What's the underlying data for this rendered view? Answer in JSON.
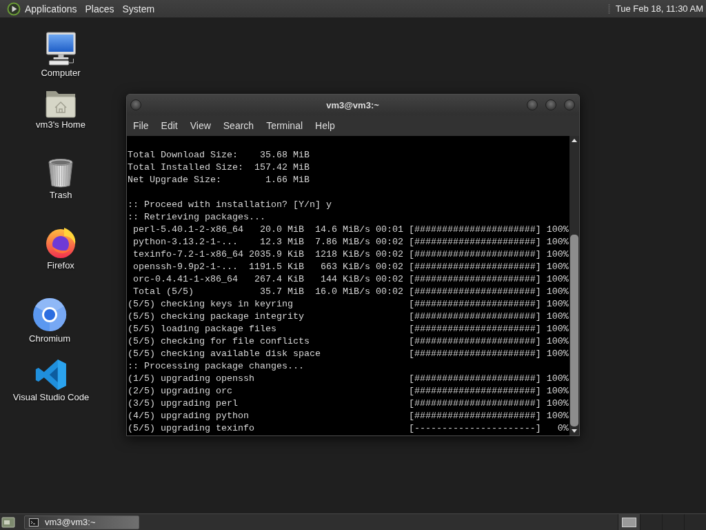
{
  "top_panel": {
    "menus": [
      "Applications",
      "Places",
      "System"
    ],
    "clock": "Tue Feb 18, 11:30 AM"
  },
  "desktop_icons": [
    {
      "kind": "computer",
      "label": "Computer"
    },
    {
      "kind": "home",
      "label": "vm3's Home"
    },
    {
      "kind": "trash",
      "label": "Trash"
    },
    {
      "kind": "firefox",
      "label": "Firefox"
    },
    {
      "kind": "chromium",
      "label": "Chromium"
    },
    {
      "kind": "vscode",
      "label": "Visual Studio Code"
    }
  ],
  "terminal_window": {
    "title": "vm3@vm3:~",
    "menu": [
      "File",
      "Edit",
      "View",
      "Search",
      "Terminal",
      "Help"
    ],
    "sections": [
      {
        "lines": [
          "Total Download Size:    35.68 MiB",
          "Total Installed Size:  157.42 MiB",
          "Net Upgrade Size:        1.66 MiB"
        ]
      },
      {
        "lines": [
          ":: Proceed with installation? [Y/n] y",
          ":: Retrieving packages...",
          " perl-5.40.1-2-x86_64   20.0 MiB  14.6 MiB/s 00:01 [######################] 100%",
          " python-3.13.2-1-...    12.3 MiB  7.86 MiB/s 00:02 [######################] 100%",
          " texinfo-7.2-1-x86_64 2035.9 KiB  1218 KiB/s 00:02 [######################] 100%",
          " openssh-9.9p2-1-...  1191.5 KiB   663 KiB/s 00:02 [######################] 100%",
          " orc-0.4.41-1-x86_64   267.4 KiB   144 KiB/s 00:02 [######################] 100%",
          " Total (5/5)            35.7 MiB  16.0 MiB/s 00:02 [######################] 100%",
          "(5/5) checking keys in keyring                     [######################] 100%",
          "(5/5) checking package integrity                   [######################] 100%",
          "(5/5) loading package files                        [######################] 100%",
          "(5/5) checking for file conflicts                  [######################] 100%",
          "(5/5) checking available disk space                [######################] 100%",
          ":: Processing package changes...",
          "(1/5) upgrading openssh                            [######################] 100%",
          "(2/5) upgrading orc                                [######################] 100%",
          "(3/5) upgrading perl                               [######################] 100%",
          "(4/5) upgrading python                             [######################] 100%",
          "(5/5) upgrading texinfo                            [----------------------]   0%"
        ]
      }
    ]
  },
  "bottom_panel": {
    "tasks": [
      {
        "label": "vm3@vm3:~",
        "selected": true
      }
    ],
    "workspaces": [
      {
        "selected": true
      },
      {
        "selected": false
      },
      {
        "selected": false
      },
      {
        "selected": false
      }
    ]
  }
}
